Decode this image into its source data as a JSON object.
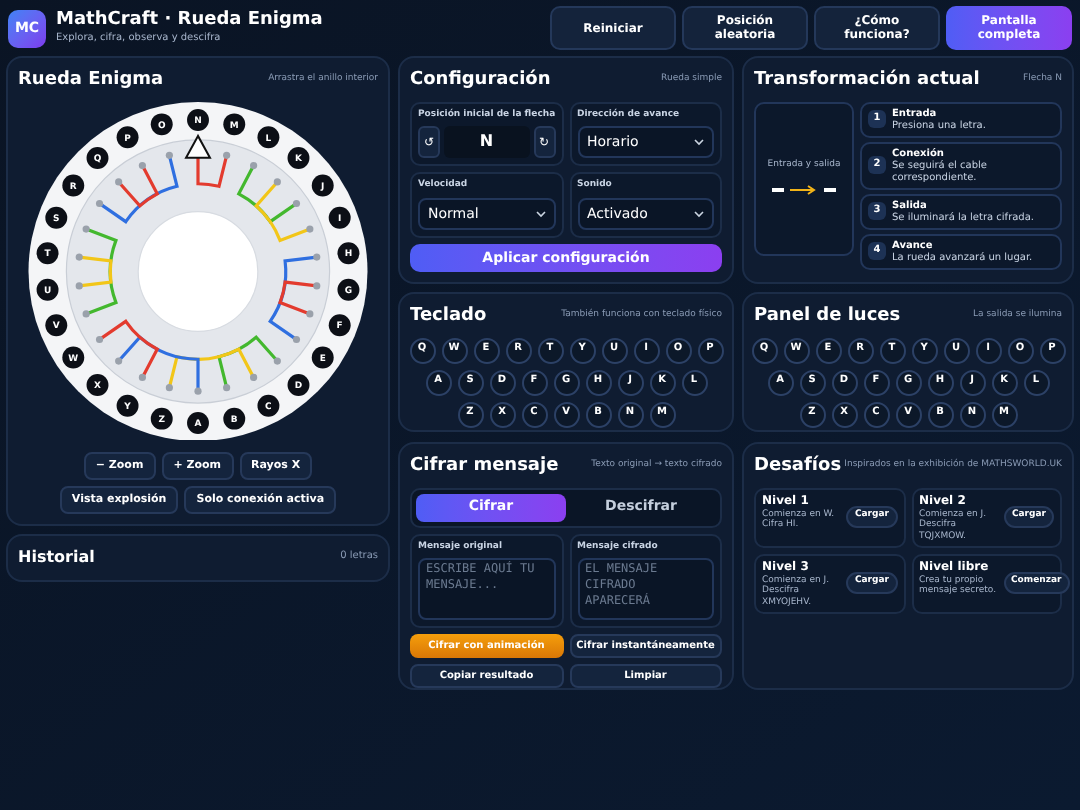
{
  "header": {
    "logo": "MC",
    "title": "MathCraft · Rueda Enigma",
    "subtitle": "Explora, cifra, observa y descifra",
    "buttons": [
      {
        "label": "Reiniciar",
        "kind": "plain"
      },
      {
        "label": "Posición aleatoria",
        "kind": "plain"
      },
      {
        "label": "¿Cómo funciona?",
        "kind": "plain"
      },
      {
        "label": "Pantalla completa",
        "kind": "primary"
      }
    ]
  },
  "wheel_panel": {
    "title": "Rueda Enigma",
    "hint": "Arrastra el anillo interior",
    "letters": [
      "N",
      "M",
      "L",
      "K",
      "J",
      "I",
      "H",
      "G",
      "F",
      "E",
      "D",
      "C",
      "B",
      "A",
      "Z",
      "Y",
      "X",
      "W",
      "V",
      "U",
      "T",
      "S",
      "R",
      "Q",
      "P",
      "O"
    ],
    "buttons": [
      "− Zoom",
      "+ Zoom",
      "Rayos X",
      "Vista explosión",
      "Solo conexión activa"
    ]
  },
  "history": {
    "title": "Historial",
    "count": "0 letras"
  },
  "config": {
    "title": "Configuración",
    "hint": "Rueda simple",
    "arrow_position": {
      "label": "Posición inicial de la flecha",
      "value": "N",
      "prev": "↺",
      "next": "↻"
    },
    "direction": {
      "label": "Dirección de avance",
      "value": "Horario"
    },
    "speed": {
      "label": "Velocidad",
      "value": "Normal"
    },
    "sound": {
      "label": "Sonido",
      "value": "Activado"
    },
    "apply_button": "Aplicar configuración"
  },
  "transform": {
    "title": "Transformación actual",
    "hint": "Flecha N",
    "io_label": "Entrada y salida",
    "steps": [
      {
        "number": "1",
        "title": "Entrada",
        "text": "Presiona una letra."
      },
      {
        "number": "2",
        "title": "Conexión",
        "text": "Se seguirá el cable correspondiente."
      },
      {
        "number": "3",
        "title": "Salida",
        "text": "Se iluminará la letra cifrada."
      },
      {
        "number": "4",
        "title": "Avance",
        "text": "La rueda avanzará un lugar."
      }
    ]
  },
  "keyboard": {
    "title": "Teclado",
    "hint": "También funciona con teclado físico",
    "rows": [
      [
        "Q",
        "W",
        "E",
        "R",
        "T",
        "Y",
        "U",
        "I",
        "O",
        "P"
      ],
      [
        "A",
        "S",
        "D",
        "F",
        "G",
        "H",
        "J",
        "K",
        "L"
      ],
      [
        "Z",
        "X",
        "C",
        "V",
        "B",
        "N",
        "M"
      ]
    ]
  },
  "lights": {
    "title": "Panel de luces",
    "hint": "La salida se ilumina",
    "rows": [
      [
        "Q",
        "W",
        "E",
        "R",
        "T",
        "Y",
        "U",
        "I",
        "O",
        "P"
      ],
      [
        "A",
        "S",
        "D",
        "F",
        "G",
        "H",
        "J",
        "K",
        "L"
      ],
      [
        "Z",
        "X",
        "C",
        "V",
        "B",
        "N",
        "M"
      ]
    ]
  },
  "cipher": {
    "title": "Cifrar mensaje",
    "hint": "Texto original → texto cifrado",
    "modes": [
      {
        "label": "Cifrar",
        "selected": true
      },
      {
        "label": "Descifrar",
        "selected": false
      }
    ],
    "original": {
      "label": "Mensaje original",
      "placeholder": "ESCRIBE AQUÍ TU MENSAJE..."
    },
    "ciphered": {
      "label": "Mensaje cifrado",
      "placeholder": "EL MENSAJE CIFRADO APARECERÁ"
    },
    "buttons": [
      {
        "label": "Cifrar con animación",
        "kind": "accent"
      },
      {
        "label": "Cifrar instantáneamente",
        "kind": "plain"
      },
      {
        "label": "Copiar resultado",
        "kind": "plain"
      },
      {
        "label": "Limpiar",
        "kind": "plain"
      }
    ]
  },
  "challenges": {
    "title": "Desafíos",
    "hint": "Inspirados en la exhibición de MATHSWORLD.UK",
    "levels": [
      {
        "title": "Nivel 1",
        "text": "Comienza en W. Cifra HI.",
        "button": "Cargar"
      },
      {
        "title": "Nivel 2",
        "text": "Comienza en J. Descifra TQJXMOW.",
        "button": "Cargar"
      },
      {
        "title": "Nivel 3",
        "text": "Comienza en J. Descifra XMYOJEHV.",
        "button": "Cargar"
      },
      {
        "title": "Nivel libre",
        "text": "Crea tu propio mensaje secreto.",
        "button": "Comenzar"
      }
    ]
  }
}
